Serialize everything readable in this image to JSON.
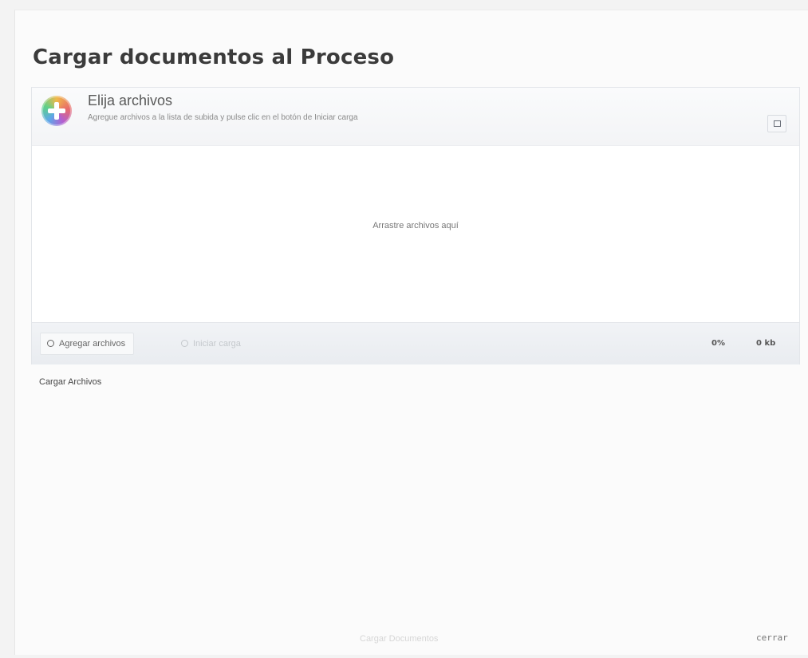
{
  "page": {
    "title": "Cargar documentos al Proceso"
  },
  "uploader": {
    "header": {
      "icon": "add-plus-icon",
      "title": "Elija archivos",
      "subtitle": "Agregue archivos a la lista de subida y pulse clic en el botón de Iniciar carga"
    },
    "drop_zone": {
      "text": "Arrastre archivos aquí"
    },
    "footer": {
      "add_button_label": "Agregar archivos",
      "start_button_label": "Iniciar carga",
      "percent": "0%",
      "size": "0 kb"
    }
  },
  "section": {
    "label": "Cargar Archivos"
  },
  "bottom": {
    "faint_label": "Cargar Documentos",
    "close_label": "cerrar"
  }
}
